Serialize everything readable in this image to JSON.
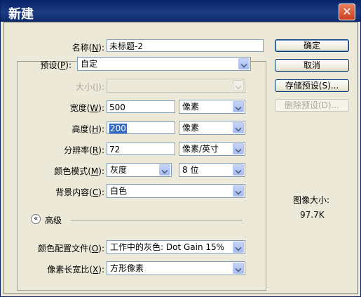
{
  "window": {
    "title": "新建",
    "close_glyph": "✕"
  },
  "form": {
    "name": {
      "label": "名称",
      "key": "N",
      "value": "未标题-2"
    },
    "preset": {
      "label": "预设",
      "key": "P",
      "value": "自定"
    },
    "size": {
      "label": "大小",
      "key": "I",
      "value": ""
    },
    "width": {
      "label": "宽度",
      "key": "W",
      "value": "500",
      "unit": "像素"
    },
    "height": {
      "label": "高度",
      "key": "H",
      "value": "200",
      "unit": "像素"
    },
    "resolution": {
      "label": "分辨率",
      "key": "R",
      "value": "72",
      "unit": "像素/英寸"
    },
    "color_mode": {
      "label": "颜色模式",
      "key": "M",
      "value": "灰度",
      "depth": "8 位"
    },
    "background": {
      "label": "背景内容",
      "key": "C",
      "value": "白色"
    },
    "advanced": {
      "label": "高级",
      "expander_glyph": "«"
    },
    "color_profile": {
      "label": "颜色配置文件",
      "key": "O",
      "value": "工作中的灰色: Dot Gain 15%"
    },
    "pixel_aspect": {
      "label": "像素长宽比",
      "key": "X",
      "value": "方形像素"
    }
  },
  "buttons": {
    "ok": "确定",
    "cancel": "取消",
    "save_preset": "存储预设(S)...",
    "delete_preset": "删除预设(D)..."
  },
  "image_size": {
    "label": "图像大小:",
    "value": "97.7K"
  },
  "colors": {
    "title_bar": "#0a246a",
    "dialog_bg": "#ece9d8",
    "selection": "#316ac5",
    "close_button": "#d9532c"
  }
}
